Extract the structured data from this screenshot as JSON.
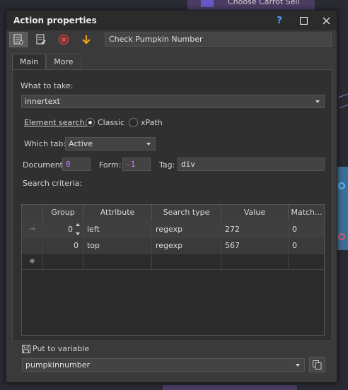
{
  "background": {
    "node_title": "Choose Carrot Sell"
  },
  "dialog": {
    "title": "Action properties",
    "help_label": "?",
    "maximize_label": "☐",
    "close_label": "✕"
  },
  "toolbar": {
    "action_name": "Check Pumpkin Number"
  },
  "tabs": [
    {
      "label": "Main",
      "active": true
    },
    {
      "label": "More",
      "active": false
    }
  ],
  "main": {
    "what_to_take_label": "What to take:",
    "what_to_take_value": "innertext",
    "element_search_label": "Element search:",
    "search_options": [
      "Classic",
      "xPath"
    ],
    "search_selected": "Classic",
    "which_tab_label": "Which tab:",
    "which_tab_value": "Active",
    "document_label": "Document:",
    "document_value": "0",
    "form_label": "Form:",
    "form_value": "-1",
    "tag_label": "Tag:",
    "tag_value": "div",
    "search_criteria_label": "Search criteria:",
    "grid": {
      "columns": [
        "Group",
        "Attribute",
        "Search type",
        "Value",
        "Match..."
      ],
      "rows": [
        {
          "indicator": "→",
          "group": "0",
          "attribute": "left",
          "search_type": "regexp",
          "value": "272",
          "match": "0"
        },
        {
          "indicator": "",
          "group": "0",
          "attribute": "top",
          "search_type": "regexp",
          "value": "567",
          "match": "0"
        }
      ],
      "new_row_indicator": "✱"
    },
    "put_to_variable_label": "Put to variable",
    "variable_value": "pumpkinnumber"
  },
  "colors": {
    "record_red": "#e03b3b",
    "arrow_orange": "#f0a020",
    "accent_blue": "#4da3ff",
    "number_purple": "#c27cff"
  }
}
